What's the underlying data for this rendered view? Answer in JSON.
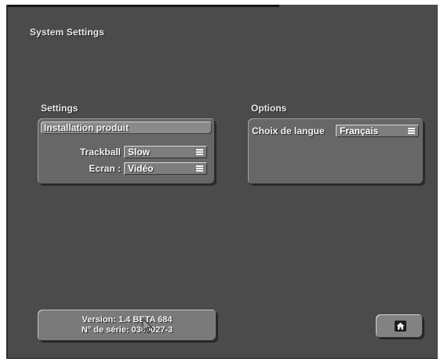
{
  "window": {
    "title": "System Settings"
  },
  "settings": {
    "section_label": "Settings",
    "install_button_label": "Installation produit",
    "trackball": {
      "label": "Trackball",
      "value": "Slow"
    },
    "ecran": {
      "label": "Ecran :",
      "value": "Vidéo"
    }
  },
  "options": {
    "section_label": "Options",
    "langue": {
      "label": "Choix de langue",
      "value": "Français"
    }
  },
  "footer": {
    "version_line": "Version: 1.4 BETA 684",
    "serial_line": "N° de série: 0300027-3"
  },
  "icons": {
    "dropdown_icon": "menu-lines-icon",
    "home_icon": "home-icon",
    "cursor_icon": "arrow-cursor-icon"
  },
  "colors": {
    "background": "#4b4b4b",
    "panel": "#666666",
    "control": "#7d7d7d",
    "text": "#f0f0f0"
  }
}
